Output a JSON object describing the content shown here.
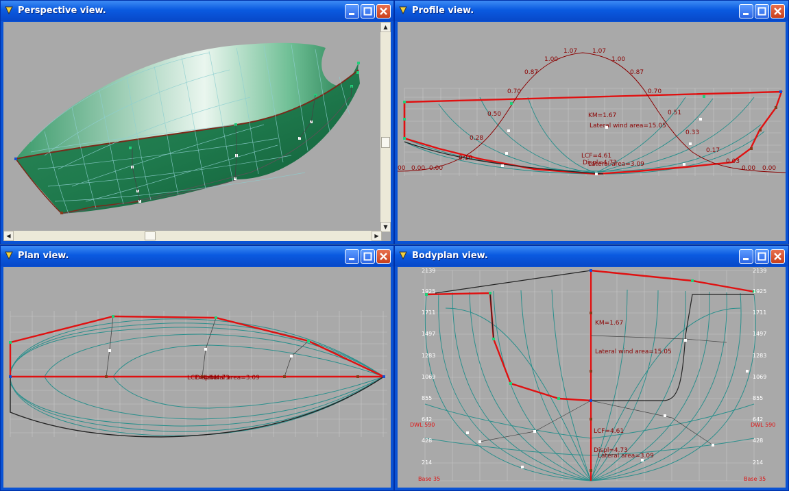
{
  "windows": {
    "perspective": {
      "title": "Perspective view."
    },
    "profile": {
      "title": "Profile view."
    },
    "plan": {
      "title": "Plan view."
    },
    "bodyplan": {
      "title": "Bodyplan view."
    }
  },
  "controls": {
    "minimize": "minimize",
    "maximize": "maximize",
    "close": "close"
  },
  "profile_view": {
    "curve_labels": [
      "1.00",
      "1.07",
      "1.07",
      "1.00",
      "0.87",
      "0.87",
      "0.70",
      "0.70",
      "0.50",
      "0.51",
      "0.28",
      "0.33",
      "0.17",
      "0.10",
      "0.03",
      "00",
      "0.00",
      "0.00",
      "0.00",
      "0.00"
    ],
    "km": "KM=1.67",
    "lateral_wind_area": "Lateral wind area=15.05",
    "lcf": "LCF=4.61",
    "displ": "Displ=4.73",
    "lateral_area": "Lateral area=3.09"
  },
  "plan_view": {
    "overlap_label_1": "LCF=4.61",
    "overlap_label_2": "Displ=4.73",
    "overlap_label_3": "Lateral area=3.09"
  },
  "bodyplan_view": {
    "left_scale": [
      "2139",
      "1925",
      "1711",
      "1497",
      "1283",
      "1069",
      "855",
      "642",
      "428",
      "214"
    ],
    "right_scale": [
      "2139",
      "1925",
      "1711",
      "1497",
      "1283",
      "1069",
      "855",
      "642",
      "428",
      "214"
    ],
    "dwl_left": "DWL 590",
    "dwl_right": "DWL 590",
    "base_left": "Base 35",
    "base_right": "Base 35",
    "km": "KM=1.67",
    "lateral_wind_area": "Lateral wind area=15.05",
    "lcf": "LCF=4.61",
    "displ": "Displ=4.73",
    "lateral_area": "Lateral area=3.09"
  },
  "colors": {
    "hull_green": "#1f7a4d",
    "curve_teal": "#2a8f8c",
    "edge_red": "#e01010",
    "view_bg": "#a9a9a9",
    "label_red": "#8b0000"
  }
}
